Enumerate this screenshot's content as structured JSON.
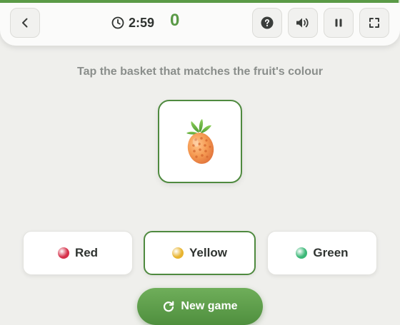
{
  "header": {
    "progress": 0.997,
    "timer": "2:59",
    "score": "0",
    "icons": {
      "back": "chevron-left-icon",
      "timer": "clock-icon",
      "help": "help-icon",
      "sound": "speaker-icon",
      "pause": "pause-icon",
      "fullscreen": "fullscreen-icon"
    }
  },
  "prompt": "Tap the basket that matches the fruit's colour",
  "fruit": {
    "icon": "pineapple-icon"
  },
  "options": [
    {
      "label": "Red",
      "color": "#d6314a",
      "selected": false
    },
    {
      "label": "Yellow",
      "color": "#e8b430",
      "selected": true
    },
    {
      "label": "Green",
      "color": "#3cb878",
      "selected": false
    }
  ],
  "new_game": {
    "label": "New game",
    "icon": "refresh-icon"
  },
  "colors": {
    "accent": "#5a9a46",
    "background": "#efefec"
  }
}
